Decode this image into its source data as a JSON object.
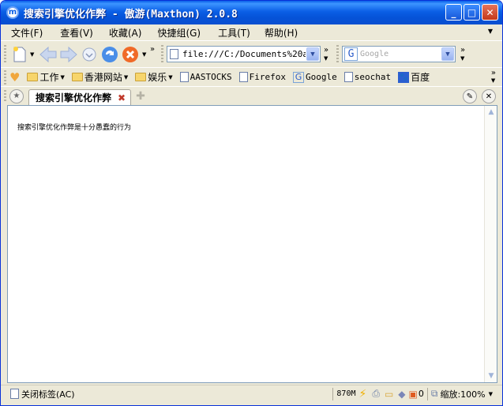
{
  "window": {
    "title": "搜索引擎优化作弊 - 傲游(Maxthon) 2.0.8"
  },
  "menu": [
    "文件(F)",
    "查看(V)",
    "收藏(A)",
    "快捷组(G)",
    "工具(T)",
    "帮助(H)"
  ],
  "toolbar": {
    "address": "file:///C:/Documents%20and",
    "search_placeholder": "Google"
  },
  "favorites": [
    {
      "label": "工作",
      "kind": "folder"
    },
    {
      "label": "香港网站",
      "kind": "folder"
    },
    {
      "label": "娱乐",
      "kind": "folder"
    },
    {
      "label": "AASTOCKS",
      "kind": "page"
    },
    {
      "label": "Firefox",
      "kind": "page"
    },
    {
      "label": "Google",
      "kind": "google"
    },
    {
      "label": "seochat",
      "kind": "page"
    },
    {
      "label": "百度",
      "kind": "baidu"
    }
  ],
  "tab": {
    "label": "搜索引擎优化作弊"
  },
  "content": {
    "text": "搜索引擎优化作弊是十分愚蠢的行为"
  },
  "status": {
    "close_tab": "关闭标签(AC)",
    "memory": "870M",
    "popup_count": "0",
    "zoom": "缩放:100%"
  },
  "colors": {
    "titlebar": "#0b5fe6",
    "chrome": "#ece9d8"
  }
}
